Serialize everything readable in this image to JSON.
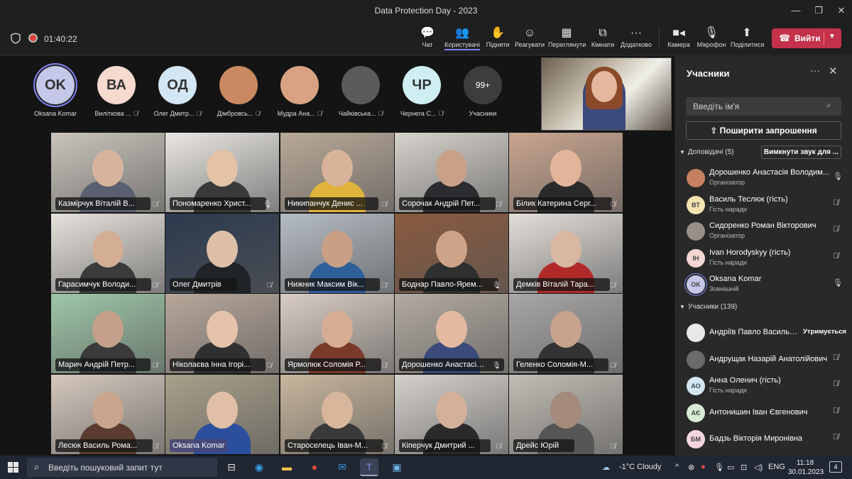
{
  "window": {
    "title": "Data Protection Day - 2023"
  },
  "toolbar": {
    "timer": "01:40:22",
    "buttons": [
      {
        "label": "Чат",
        "icon": "chat-icon"
      },
      {
        "label": "Користувачі",
        "icon": "people-icon"
      },
      {
        "label": "Підняти",
        "icon": "raise-hand-icon"
      },
      {
        "label": "Реагувати",
        "icon": "react-icon"
      },
      {
        "label": "Переглянути",
        "icon": "view-icon"
      },
      {
        "label": "Кімнати",
        "icon": "rooms-icon"
      },
      {
        "label": "Додатково",
        "icon": "more-icon"
      },
      {
        "label": "Камера",
        "icon": "camera-icon"
      },
      {
        "label": "Мікрофон",
        "icon": "mic-icon"
      },
      {
        "label": "Поділитися",
        "icon": "share-icon"
      }
    ],
    "leave_label": "Вийти"
  },
  "avatars": [
    {
      "initials": "OK",
      "name": "Oksana Komar",
      "color": "#c5c8e8",
      "muted": false,
      "self": true
    },
    {
      "initials": "ВА",
      "name": "Виліткова ...",
      "color": "#f6d9cf",
      "muted": true
    },
    {
      "initials": "ОД",
      "name": "Олег Дмитр...",
      "color": "#d3e6f3",
      "muted": true
    },
    {
      "initials": "",
      "name": "Дімбровсь...",
      "color": "#c98a63",
      "muted": true
    },
    {
      "initials": "",
      "name": "Мудра Ана...",
      "color": "#d9a383",
      "muted": true
    },
    {
      "initials": "",
      "name": "Чайківська...",
      "color": "#5b5b5b",
      "muted": true
    },
    {
      "initials": "ЧР",
      "name": "Чернега С...",
      "color": "#cfeef2",
      "muted": true
    },
    {
      "initials": "99+",
      "name": "Учасники",
      "color": "#3d3d3d",
      "muted": false
    }
  ],
  "tiles": [
    {
      "name": "Казмірчук Віталій В...",
      "bg": "#c9c4bc",
      "skin": "#d8b49c",
      "cloth": "#5a6070",
      "muted": true
    },
    {
      "name": "Пономаренко Христ...",
      "bg": "#e9e6e2",
      "skin": "#e3c2a6",
      "cloth": "#3a3a3a",
      "muted": false
    },
    {
      "name": "Никипанчук Денис ...",
      "bg": "#b9a998",
      "skin": "#d7b399",
      "cloth": "#e0b43a",
      "muted": true
    },
    {
      "name": "Сорочак Андрій Пет...",
      "bg": "#d6d2cc",
      "skin": "#c9a189",
      "cloth": "#2c2c30",
      "muted": true
    },
    {
      "name": "Білик Катерина Серг...",
      "bg": "#caa690",
      "skin": "#e2b59a",
      "cloth": "#2a2a2a",
      "muted": true
    },
    {
      "name": "Гарасимчук Володи...",
      "bg": "#e6e2dc",
      "skin": "#d3ae95",
      "cloth": "#3b3b3b",
      "muted": true
    },
    {
      "name": "Олег Дмитрів",
      "bg": "#2c3a4e",
      "skin": "#ddbfa8",
      "cloth": "#202428",
      "muted": true
    },
    {
      "name": "Нижник Максим Вік...",
      "bg": "#b5bcc4",
      "skin": "#c99f85",
      "cloth": "#2f5f9a",
      "muted": true
    },
    {
      "name": "Боднар Павло-Ярем...",
      "bg": "#8a5a3e",
      "skin": "#cda487",
      "cloth": "#2f2f2f",
      "muted": false
    },
    {
      "name": "Демків Віталій Тара...",
      "bg": "#e3dfdb",
      "skin": "#d8b8a0",
      "cloth": "#b02a2a",
      "muted": true
    },
    {
      "name": "Марич Андрій Петр...",
      "bg": "#9ec7a8",
      "skin": "#c4a08a",
      "cloth": "#3a3a3a",
      "muted": true
    },
    {
      "name": "Ніколаєва Інна Ігорі...",
      "bg": "#b8a79a",
      "skin": "#e4c3aa",
      "cloth": "#303030",
      "muted": true
    },
    {
      "name": "Ярмолюк Соломія Р...",
      "bg": "#d9cdc4",
      "skin": "#d6ad93",
      "cloth": "#7a3a2a",
      "muted": true
    },
    {
      "name": "Дорошенко Анастасія ...",
      "bg": "#b3aba2",
      "skin": "#e3b99f",
      "cloth": "#3a4a7a",
      "muted": false
    },
    {
      "name": "Геленко Соломія-М...",
      "bg": "#a9a7a6",
      "skin": "#c7a28c",
      "cloth": "#333333",
      "muted": true
    },
    {
      "name": "Лесюк Василь Рома...",
      "bg": "#d5c8bd",
      "skin": "#c9a58e",
      "cloth": "#5a3c30",
      "muted": true
    },
    {
      "name": "Oksana Komar",
      "bg": "#a9a08a",
      "skin": "#e0bfa6",
      "cloth": "#2b4f9c",
      "muted": false,
      "self": true
    },
    {
      "name": "Староселець Іван-М...",
      "bg": "#c8b69d",
      "skin": "#d8b69c",
      "cloth": "#3a3a3a",
      "muted": true
    },
    {
      "name": "Кіперчук Дмитрий ...",
      "bg": "#d4d0cc",
      "skin": "#d2b09a",
      "cloth": "#2a2a2a",
      "muted": true
    },
    {
      "name": "Дрейс Юрій",
      "bg": "#c2bcb4",
      "skin": "#a38a7a",
      "cloth": "#565656",
      "muted": true
    }
  ],
  "panel": {
    "title": "Учасники",
    "search_placeholder": "Введіть ім'я",
    "invite_label": "Поширити запрошення",
    "presenters_header": "Доповідачі (5)",
    "mute_all_label": "Вимкнути звук для ...",
    "presenters": [
      {
        "name": "Дорошенко Анастасія Володим...",
        "role": "Організатор",
        "initials": "",
        "color": "#c58060",
        "mic": "on"
      },
      {
        "name": "Василь Теслюк (гість)",
        "role": "Гість наради",
        "initials": "ВТ",
        "color": "#f3e3b0",
        "mic": "off"
      },
      {
        "name": "Сидоренко Роман Вікторович",
        "role": "Організатор",
        "initials": "",
        "color": "#9a8f86",
        "mic": "off"
      },
      {
        "name": "Ivan Horodyskyy (гість)",
        "role": "Гість наради",
        "initials": "IH",
        "color": "#f4d6d3",
        "mic": "off"
      },
      {
        "name": "Oksana Komar",
        "role": "Зовнішній",
        "initials": "OK",
        "color": "#c5c8e8",
        "mic": "on"
      }
    ],
    "attendees_header": "Учасники (139)",
    "attendees": [
      {
        "name": "Андріїв Павло Васильов...",
        "role": "",
        "initials": "",
        "color": "#e8e8e8",
        "mic": "",
        "status": "Утримується"
      },
      {
        "name": "Андрущак Назарій Анатолійович",
        "role": "",
        "initials": "",
        "color": "#6b6b6b",
        "mic": "off"
      },
      {
        "name": "Анна Оленич (гість)",
        "role": "Гість наради",
        "initials": "АО",
        "color": "#d3e6f3",
        "mic": "off"
      },
      {
        "name": "Антонишин Іван Євгенович",
        "role": "",
        "initials": "АЄ",
        "color": "#d8ecd4",
        "mic": "off"
      },
      {
        "name": "Бадзь Вікторія Миронівна",
        "role": "",
        "initials": "БМ",
        "color": "#f4d6e0",
        "mic": "off"
      }
    ]
  },
  "taskbar": {
    "search_placeholder": "Введіть пошуковий запит тут",
    "weather": "-1°C  Cloudy",
    "lang": "ENG",
    "time": "11:18",
    "date": "30.01.2023",
    "notifications": "4"
  }
}
